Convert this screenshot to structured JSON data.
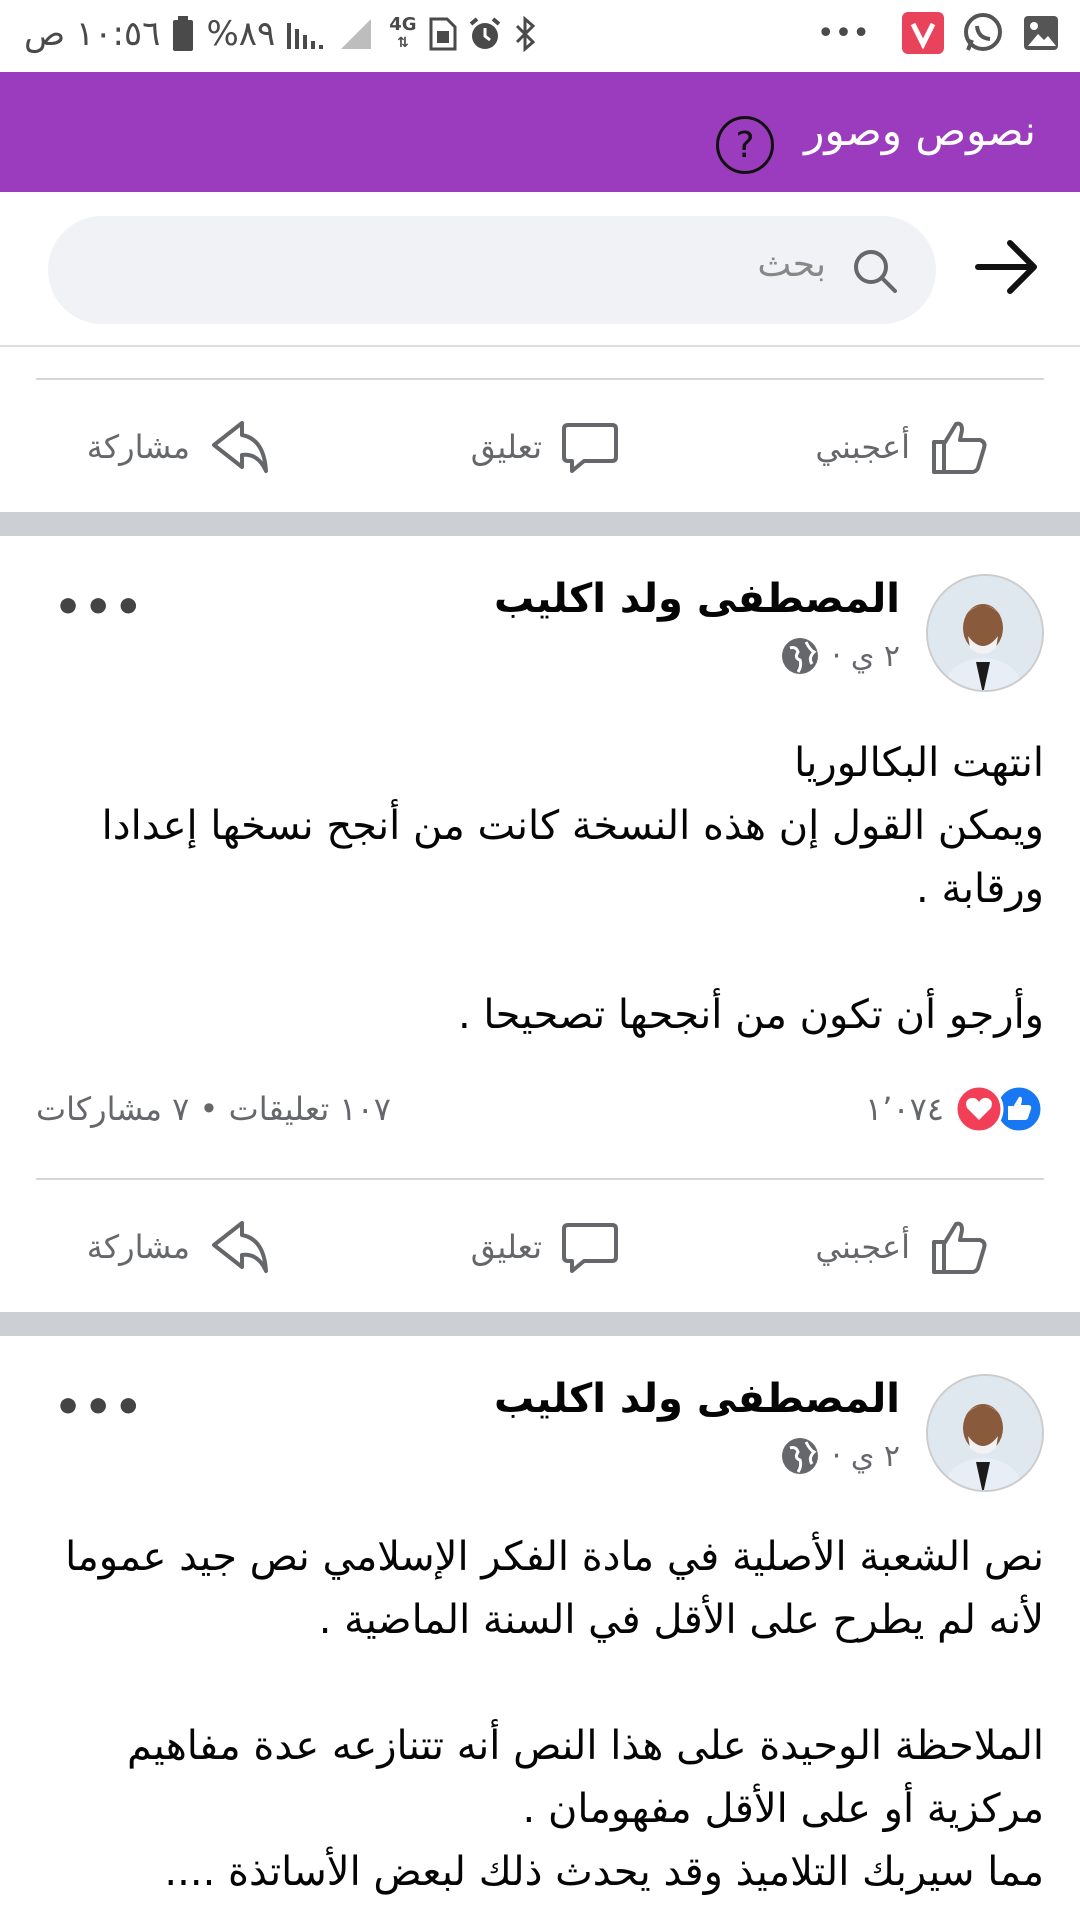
{
  "status_bar": {
    "time": "١٠:٥٦ ص",
    "battery": "%٨٩",
    "network": "4G"
  },
  "header": {
    "title": "نصوص وصور",
    "help_symbol": "?",
    "bg_color": "#9b3cbe"
  },
  "search": {
    "placeholder": "بحث"
  },
  "actions": {
    "like": "أعجبني",
    "comment": "تعليق",
    "share": "مشاركة"
  },
  "posts": [
    {
      "author": "المصطفى ولد اكليب",
      "time": "٢ ي ·",
      "privacy_icon": "globe-icon",
      "body": "انتهت البكالوريا\nويمكن القول إن هذه النسخة كانت من أنجح نسخها إعدادا ورقابة .\n\nوأرجو أن تكون من أنجحها تصحيحا .",
      "reactions_count": "١٬٠٧٤",
      "comments_shares": "١٠٧ تعليقات • ٧ مشاركات"
    },
    {
      "author": "المصطفى ولد اكليب",
      "time": "٢ ي ·",
      "privacy_icon": "globe-icon",
      "body": "نص الشعبة الأصلية في مادة الفكر الإسلامي نص جيد عموما لأنه لم يطرح على الأقل في السنة الماضية .\n\nالملاحظة الوحيدة على هذا النص أنه تتنازعه عدة مفاهيم مركزية أو على الأقل مفهومان .\nمما سيربك التلاميذ وقد يحدث ذلك لبعض الأساتذة ...."
    }
  ]
}
